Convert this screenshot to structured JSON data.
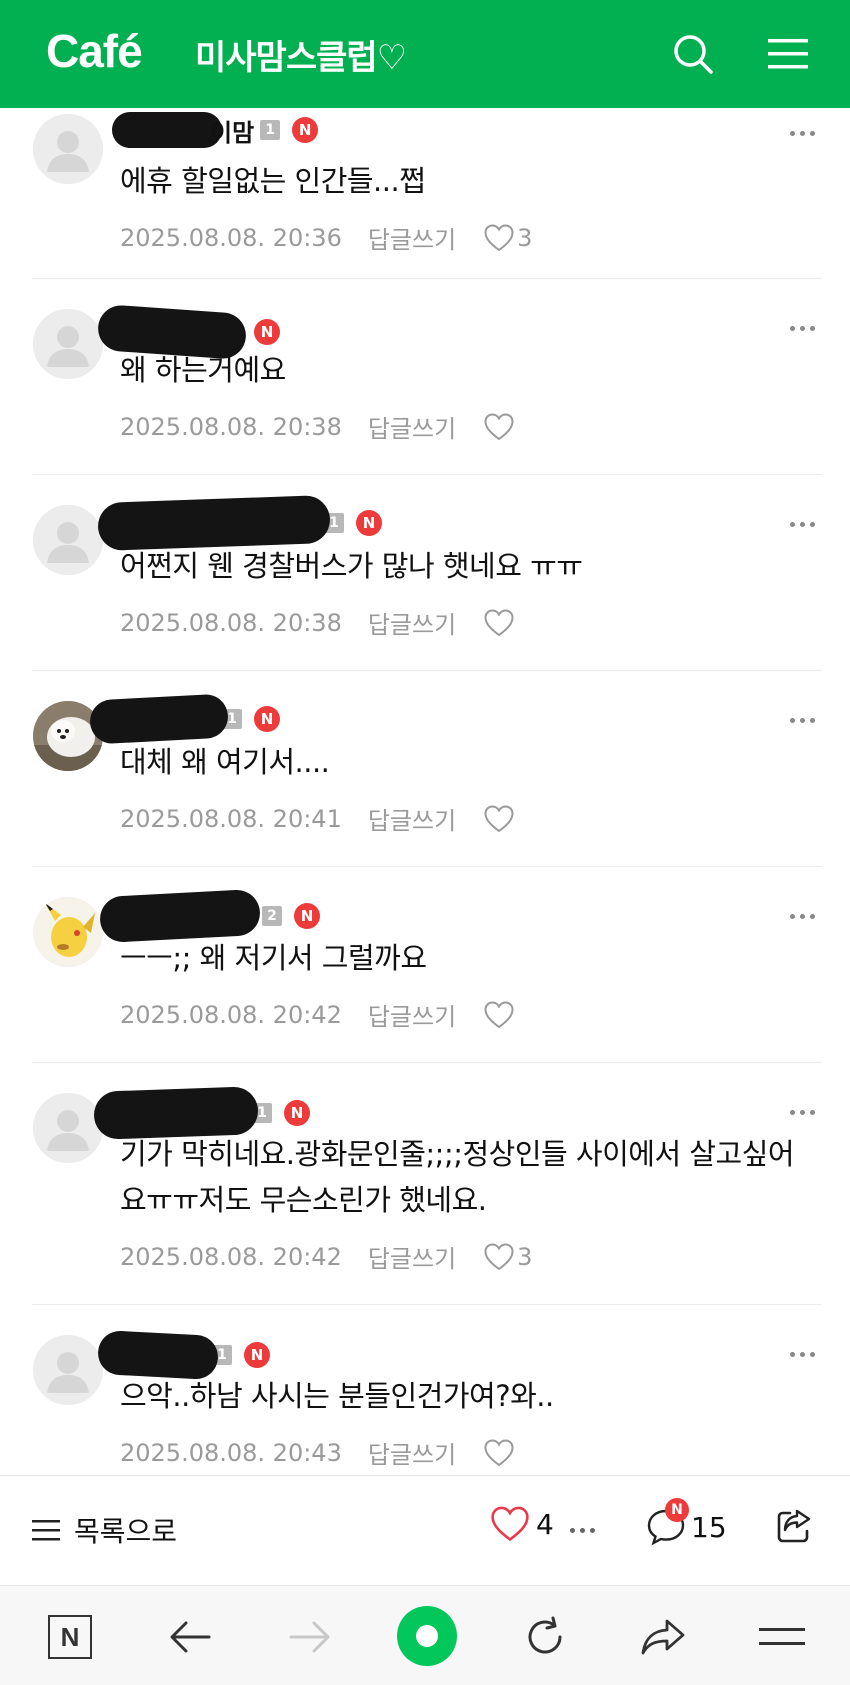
{
  "header": {
    "brand": "Café",
    "cafe_name": "미사맘스클럽♡"
  },
  "comments": [
    {
      "nickname_visible": "이맘",
      "level": "1",
      "new_badge": "N",
      "text": "에휴 할일없는 인간들...쩝",
      "date": "2025.08.08. 20:36",
      "reply": "답글쓰기",
      "likes": "3",
      "avatar": "default"
    },
    {
      "nickname_visible": "",
      "level": "",
      "new_badge": "N",
      "text": "왜 하는거예요",
      "date": "2025.08.08. 20:38",
      "reply": "답글쓰기",
      "likes": "",
      "avatar": "default"
    },
    {
      "nickname_visible": "",
      "level": "1",
      "new_badge": "N",
      "text": "어쩐지 웬 경찰버스가 많나 햇네요 ㅠㅠ",
      "date": "2025.08.08. 20:38",
      "reply": "답글쓰기",
      "likes": "",
      "avatar": "default"
    },
    {
      "nickname_visible": "",
      "level": "1",
      "new_badge": "N",
      "text": "대체 왜 여기서....",
      "date": "2025.08.08. 20:41",
      "reply": "답글쓰기",
      "likes": "",
      "avatar": "dog-photo"
    },
    {
      "nickname_visible": "",
      "level": "2",
      "new_badge": "N",
      "text": "ㅡㅡ;; 왜 저기서 그럴까요",
      "date": "2025.08.08. 20:42",
      "reply": "답글쓰기",
      "likes": "",
      "avatar": "pikachu"
    },
    {
      "nickname_visible": "",
      "level": "1",
      "new_badge": "N",
      "text": "기가 막히네요.광화문인줄;;;;정상인들 사이에서 살고싶어요ㅠㅠ저도 무슨소린가 했네요.",
      "date": "2025.08.08. 20:42",
      "reply": "답글쓰기",
      "likes": "3",
      "avatar": "default"
    },
    {
      "nickname_visible": "",
      "level": "1",
      "new_badge": "N",
      "text": "으악..하남 사시는 분들인건가여?와..",
      "date": "2025.08.08. 20:43",
      "reply": "답글쓰기",
      "likes": "",
      "avatar": "default"
    }
  ],
  "action_bar": {
    "list_label": "목록으로",
    "like_count": "4",
    "comment_badge": "N",
    "comment_count": "15"
  },
  "browser_nav": {
    "n_label": "N"
  },
  "colors": {
    "brand_green": "#03b051",
    "badge_red": "#ed3a3a",
    "like_red": "#e8384a"
  }
}
